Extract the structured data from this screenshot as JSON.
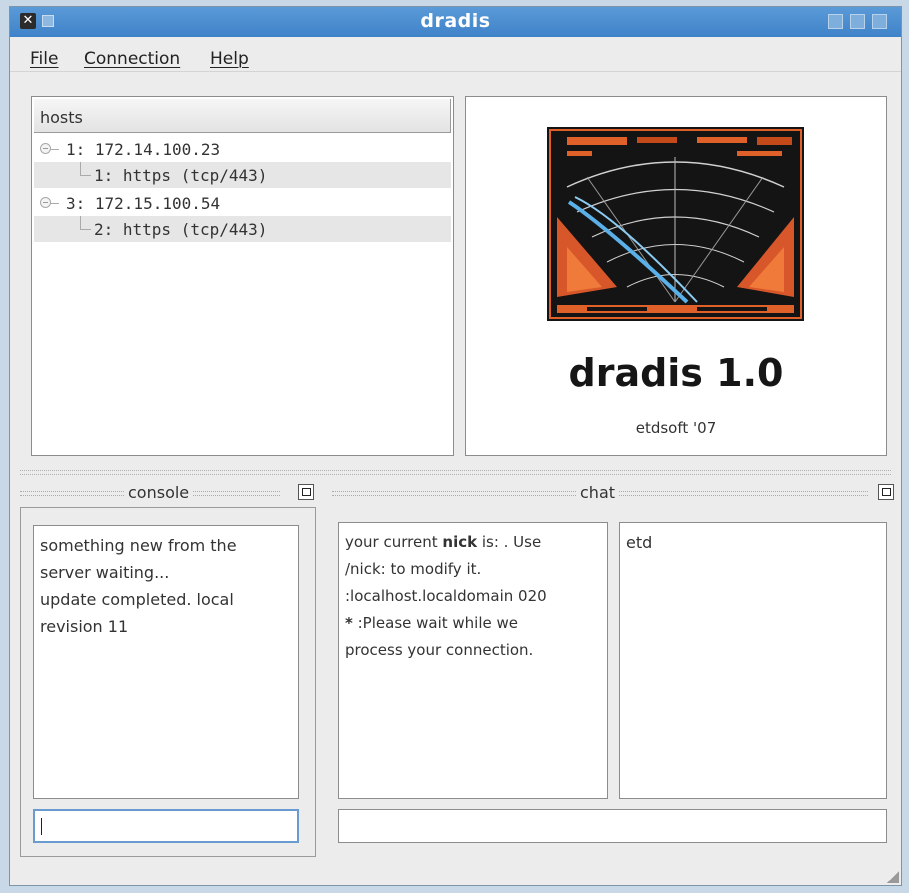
{
  "window": {
    "title": "dradis"
  },
  "menu": [
    {
      "id": "file",
      "label": "File"
    },
    {
      "id": "connection",
      "label": "Connection"
    },
    {
      "id": "help",
      "label": "Help"
    }
  ],
  "hosts": {
    "header": "hosts",
    "tree": [
      {
        "level": 0,
        "label": "1: 172.14.100.23",
        "selected": false
      },
      {
        "level": 1,
        "label": "1: https (tcp/443)",
        "selected": true
      },
      {
        "level": 0,
        "label": "3: 172.15.100.54",
        "selected": false
      },
      {
        "level": 1,
        "label": "2: https (tcp/443)",
        "selected": true
      }
    ]
  },
  "about": {
    "title": "dradis 1.0",
    "subtitle": "etdsoft '07"
  },
  "console": {
    "title": "console",
    "lines": [
      "something new from the",
      "server waiting...",
      "update completed. local",
      "revision 11"
    ],
    "input_value": ""
  },
  "chat": {
    "title": "chat",
    "messages": [
      {
        "pre": "your current ",
        "bold": "nick",
        "post": " is: . Use"
      },
      {
        "pre": "/nick: to modify it.",
        "bold": "",
        "post": ""
      },
      {
        "pre": ":localhost.localdomain 020",
        "bold": "",
        "post": ""
      },
      {
        "pre": "",
        "bold": "*",
        "post": " :Please wait while we"
      },
      {
        "pre": "process your connection.",
        "bold": "",
        "post": ""
      }
    ],
    "users": [
      "etd"
    ],
    "input_value": ""
  },
  "colors": {
    "titlebar": "#4a8ed0",
    "window_bg": "#ececec",
    "radar_orange": "#e0602a",
    "radar_blue": "#5ab0e8"
  }
}
